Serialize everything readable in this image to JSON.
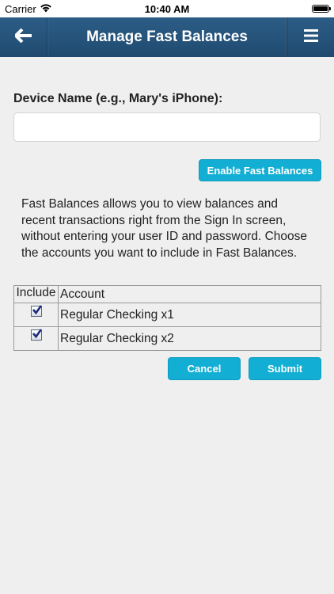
{
  "status_bar": {
    "carrier": "Carrier",
    "time": "10:40 AM",
    "battery_level": 1.0
  },
  "header": {
    "title": "Manage Fast Balances",
    "back_icon": "back-arrow-icon",
    "menu_icon": "hamburger-menu-icon"
  },
  "device": {
    "label": "Device Name (e.g., Mary's iPhone):",
    "value": "",
    "placeholder": ""
  },
  "enable_button": "Enable Fast Balances",
  "description": "Fast Balances allows you to view balances and recent transactions right from the Sign In screen, without entering your user ID and password. Choose the accounts you want to include in Fast Balances.",
  "table": {
    "headers": [
      "Include",
      "Account"
    ],
    "rows": [
      {
        "included": true,
        "account": "Regular Checking x1"
      },
      {
        "included": true,
        "account": "Regular Checking x2"
      }
    ]
  },
  "actions": {
    "cancel": "Cancel",
    "submit": "Submit"
  },
  "colors": {
    "header": "#245379",
    "button": "#13aed3",
    "background": "#efefef"
  }
}
